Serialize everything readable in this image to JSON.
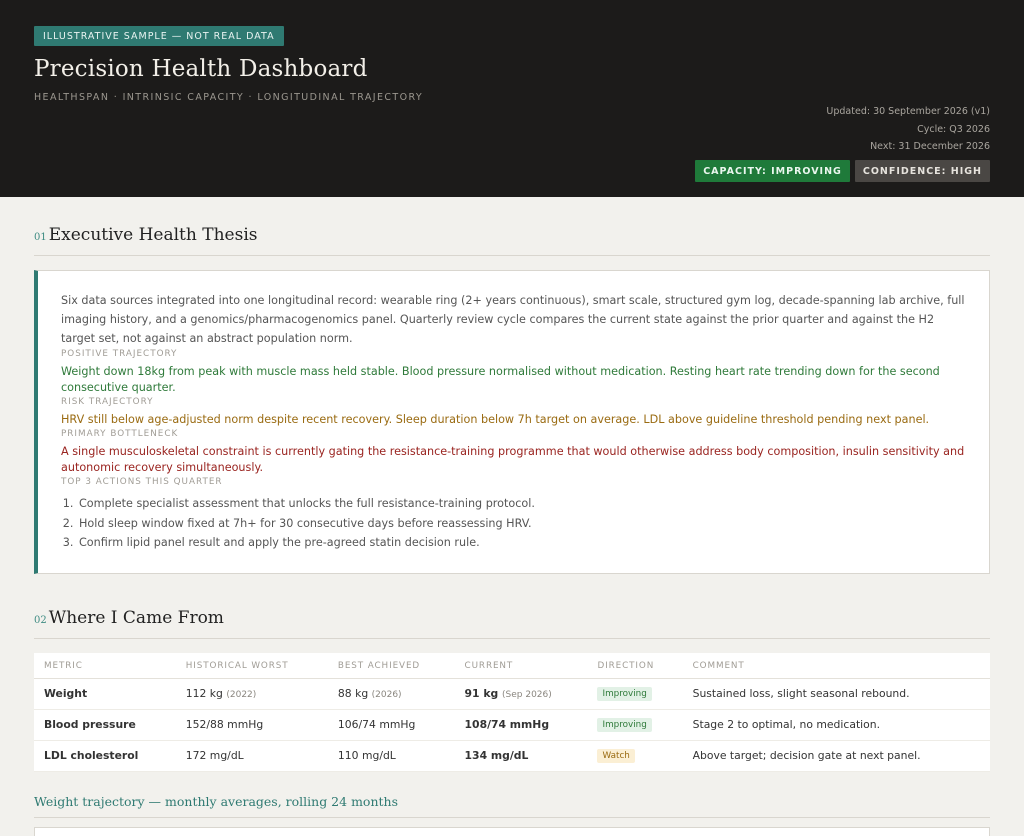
{
  "header": {
    "sample_tag": "ILLUSTRATIVE SAMPLE — NOT REAL DATA",
    "title": "Precision Health Dashboard",
    "subtitle": "HEALTHSPAN · INTRINSIC CAPACITY · LONGITUDINAL TRAJECTORY",
    "updated": "Updated: 30 September 2026 (v1)",
    "cycle": "Cycle: Q3 2026",
    "next": "Next: 31 December 2026",
    "badge_capacity": "CAPACITY: IMPROVING",
    "badge_confidence": "CONFIDENCE: HIGH"
  },
  "thesis": {
    "num": "01",
    "title": "Executive Health Thesis",
    "intro": "Six data sources integrated into one longitudinal record: wearable ring (2+ years continuous), smart scale, structured gym log, decade-spanning lab archive, full imaging history, and a genomics/pharmacogenomics panel. Quarterly review cycle compares the current state against the prior quarter and against the H2 target set, not against an abstract population norm.",
    "positive_label": "POSITIVE TRAJECTORY",
    "positive_text": "Weight down 18kg from peak with muscle mass held stable. Blood pressure normalised without medication. Resting heart rate trending down for the second consecutive quarter.",
    "risk_label": "RISK TRAJECTORY",
    "risk_text": "HRV still below age-adjusted norm despite recent recovery. Sleep duration below 7h target on average. LDL above guideline threshold pending next panel.",
    "bottleneck_label": "PRIMARY BOTTLENECK",
    "bottleneck_text": "A single musculoskeletal constraint is currently gating the resistance-training programme that would otherwise address body composition, insulin sensitivity and autonomic recovery simultaneously.",
    "actions_label": "TOP 3 ACTIONS THIS QUARTER",
    "actions": [
      "Complete specialist assessment that unlocks the full resistance-training protocol.",
      "Hold sleep window fixed at 7h+ for 30 consecutive days before reassessing HRV.",
      "Confirm lipid panel result and apply the pre-agreed statin decision rule."
    ]
  },
  "history": {
    "num": "02",
    "title": "Where I Came From",
    "columns": [
      "METRIC",
      "HISTORICAL WORST",
      "BEST ACHIEVED",
      "CURRENT",
      "DIRECTION",
      "COMMENT"
    ],
    "rows": [
      {
        "metric": "Weight",
        "worst": "112 kg",
        "worst_year": "(2022)",
        "best": "88 kg",
        "best_year": "(2026)",
        "current": "91 kg",
        "current_date": "(Sep 2026)",
        "direction": "Improving",
        "status": "green",
        "comment": "Sustained loss, slight seasonal rebound."
      },
      {
        "metric": "Blood pressure",
        "worst": "152/88 mmHg",
        "worst_year": "",
        "best": "106/74 mmHg",
        "best_year": "",
        "current": "108/74 mmHg",
        "current_date": "",
        "direction": "Improving",
        "status": "green",
        "comment": "Stage 2 to optimal, no medication."
      },
      {
        "metric": "LDL cholesterol",
        "worst": "172 mg/dL",
        "worst_year": "",
        "best": "110 mg/dL",
        "best_year": "",
        "current": "134 mg/dL",
        "current_date": "",
        "direction": "Watch",
        "status": "amber",
        "comment": "Above target; decision gate at next panel."
      }
    ],
    "chart_title": "Weight trajectory — monthly averages, rolling 24 months"
  },
  "colors": {
    "accent": "#2f7a72",
    "improving": "#1f7a3a",
    "watch": "#9a6b12",
    "bottleneck": "#9a2420",
    "hero_bg": "#1c1b1a"
  }
}
